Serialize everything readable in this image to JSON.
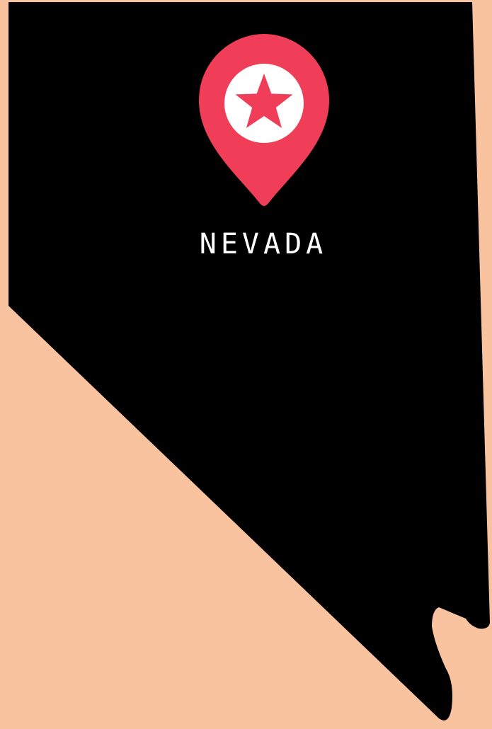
{
  "map": {
    "state_name": "NEVADA",
    "marker_icon": "map-pin-star-icon",
    "colors": {
      "background": "#F9C3A0",
      "state_fill": "#000000",
      "pin": "#F03E58",
      "pin_inner": "#FFFFFF",
      "label": "#FFFFFF"
    }
  }
}
